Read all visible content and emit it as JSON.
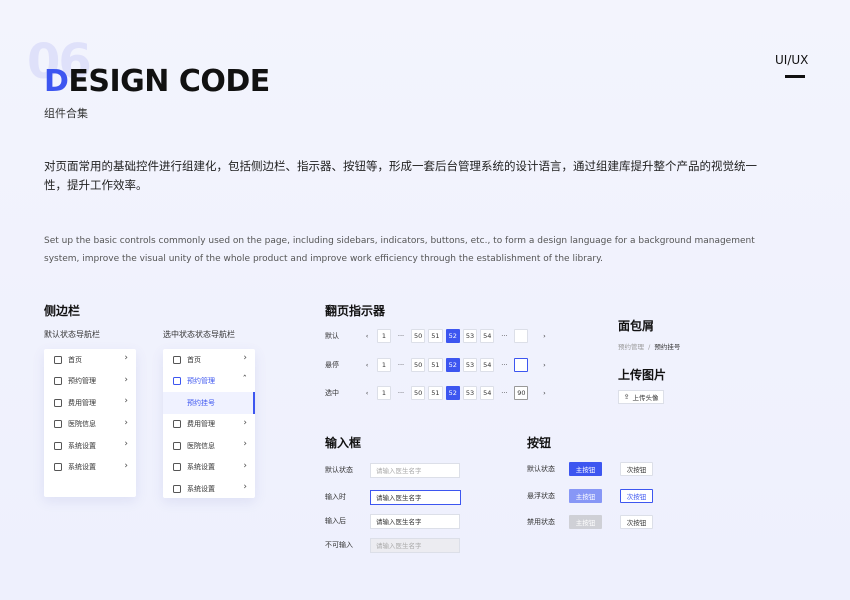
{
  "header": {
    "number": "06",
    "title_first": "D",
    "title_rest": "ESIGN CODE",
    "subtitle": "组件合集",
    "tag": "UI/UX"
  },
  "description": {
    "cn": "对页面常用的基础控件进行组建化，包括侧边栏、指示器、按钮等，形成一套后台管理系统的设计语言，通过组建库提升整个产品的视觉统一性，提升工作效率。",
    "en": "Set up the basic controls commonly used on the page, including sidebars, indicators, buttons, etc., to form a design language for a background management system, improve the visual unity of the whole product and improve work efficiency through the establishment of the library."
  },
  "sidebar_section": {
    "title": "侧边栏",
    "default_label": "默认状态导航栏",
    "selected_label": "选中状态状态导航栏",
    "default_items": [
      {
        "label": "首页",
        "icon": "monitor-icon"
      },
      {
        "label": "预约管理",
        "icon": "calendar-icon"
      },
      {
        "label": "费用管理",
        "icon": "wallet-icon"
      },
      {
        "label": "医院信息",
        "icon": "hospital-icon"
      },
      {
        "label": "系统设置",
        "icon": "gear-icon"
      },
      {
        "label": "系统设置",
        "icon": "gear-icon"
      }
    ],
    "selected_items": {
      "home": "首页",
      "booking": "预约管理",
      "sub": "预约挂号",
      "fee": "费用管理",
      "hospital": "医院信息",
      "settings1": "系统设置",
      "settings2": "系统设置"
    }
  },
  "pagination": {
    "title": "翻页指示器",
    "rows": [
      {
        "label": "默认",
        "end": ""
      },
      {
        "label": "悬停",
        "end": ""
      },
      {
        "label": "选中",
        "end": "90"
      }
    ],
    "prev": "‹",
    "next": "›",
    "first": "1",
    "ellipsis": "···",
    "pages": [
      "50",
      "51",
      "52",
      "53",
      "54"
    ],
    "current": "52"
  },
  "breadcrumb": {
    "title": "面包屑",
    "parent": "预约管理",
    "separator": "/",
    "current": "预约挂号"
  },
  "upload": {
    "title": "上传图片",
    "button": "上传头像",
    "icon": "upload-icon"
  },
  "inputs": {
    "title": "输入框",
    "rows": [
      {
        "label": "默认状态",
        "value": "请输入医生名字"
      },
      {
        "label": "输入时",
        "value": "请输入医生名字"
      },
      {
        "label": "输入后",
        "value": "请输入医生名字"
      },
      {
        "label": "不可输入",
        "value": "请输入医生名字"
      }
    ]
  },
  "buttons": {
    "title": "按钮",
    "rows": [
      {
        "label": "默认状态",
        "primary": "主按钮",
        "secondary": "次按钮"
      },
      {
        "label": "悬浮状态",
        "primary": "主按钮",
        "secondary": "次按钮"
      },
      {
        "label": "禁用状态",
        "primary": "主按钮",
        "secondary": "次按钮"
      }
    ]
  },
  "colors": {
    "accent": "#3d56f0",
    "hover": "#8797f6",
    "disabled": "#cfd0d6"
  }
}
